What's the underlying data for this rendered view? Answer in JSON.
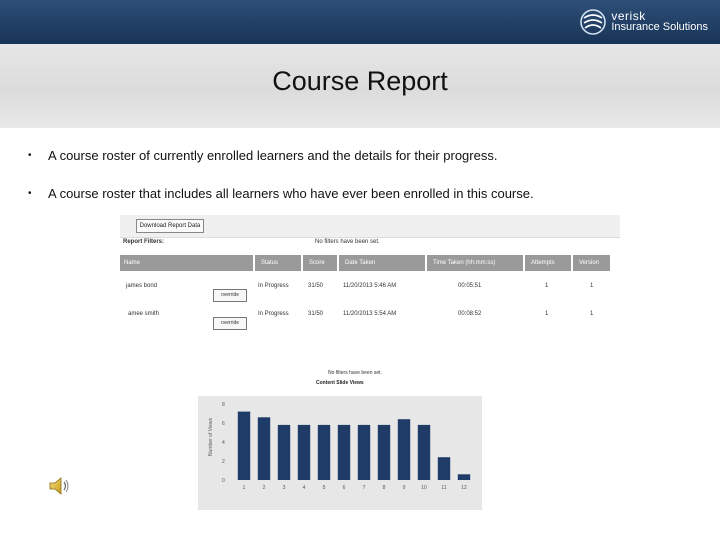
{
  "header": {
    "logo_line1": "verisk",
    "logo_line2": "Insurance Solutions",
    "colors": {
      "bar_top": "#2e4f78",
      "bar_bottom": "#183357"
    }
  },
  "slide": {
    "title": "Course Report",
    "bullets": [
      "A course roster of currently enrolled learners and the details for their progress.",
      "A course roster that includes all learners who have ever been enrolled in this course."
    ]
  },
  "report": {
    "download_button": "Download Report Data",
    "filters_label": "Report Filters:",
    "no_filters": "No filters have been set.",
    "columns": [
      "Name",
      "Status",
      "Score",
      "Date Taken",
      "Time Taken (hh:mm:ss)",
      "Attempts",
      "Version"
    ],
    "rows": [
      {
        "name": "james bond",
        "override": "override",
        "status": "In Progress",
        "score": "31/50",
        "date": "11/20/2013 5:46 AM",
        "time": "00:05:51",
        "attempts": "1",
        "version": "1"
      },
      {
        "name": "amee smith",
        "override": "override",
        "status": "In Progress",
        "score": "31/50",
        "date": "11/20/2013 5:54 AM",
        "time": "00:08:52",
        "attempts": "1",
        "version": "1"
      }
    ]
  },
  "chart_data": {
    "type": "bar",
    "title": "Content Slide Views",
    "subtitle": "No filters have been set.",
    "ylabel": "Number of Views",
    "xlabel": "",
    "categories": [
      "1",
      "2",
      "3",
      "4",
      "5",
      "6",
      "7",
      "8",
      "9",
      "10",
      "11",
      "12"
    ],
    "values": [
      7.2,
      6.6,
      5.8,
      5.8,
      5.8,
      5.8,
      5.8,
      5.8,
      6.4,
      5.8,
      2.4,
      0.6
    ],
    "ylim": [
      0,
      8
    ],
    "yticks": [
      "0",
      "2",
      "4",
      "6",
      "8"
    ],
    "colors": {
      "bar": "#1f3c68",
      "plot_bg": "#e7e7e7"
    }
  },
  "icons": {
    "speaker": "speaker-icon",
    "logo": "verisk-logo-mark"
  }
}
